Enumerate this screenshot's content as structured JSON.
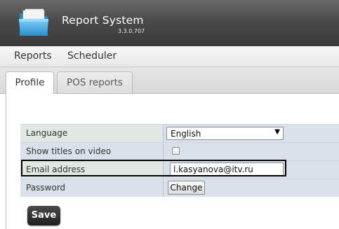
{
  "app": {
    "title": "Report System",
    "version": "3.3.0.707",
    "logo_icon": "folder-icon"
  },
  "menu": {
    "items": [
      {
        "label": "Reports"
      },
      {
        "label": "Scheduler"
      }
    ]
  },
  "tabs": [
    {
      "label": "Profile",
      "active": true
    },
    {
      "label": "POS reports",
      "active": false
    }
  ],
  "form": {
    "language": {
      "label": "Language",
      "value": "English"
    },
    "show_titles": {
      "label": "Show titles on video",
      "checked": false
    },
    "email": {
      "label": "Email address",
      "value": "l.kasyanova@itv.ru"
    },
    "password": {
      "label": "Password",
      "button_label": "Change"
    }
  },
  "actions": {
    "save_label": "Save"
  },
  "colors": {
    "header_bg": "#4a4a4a",
    "save_button_bg": "#2b2b2b",
    "highlight_border": "#000000"
  }
}
